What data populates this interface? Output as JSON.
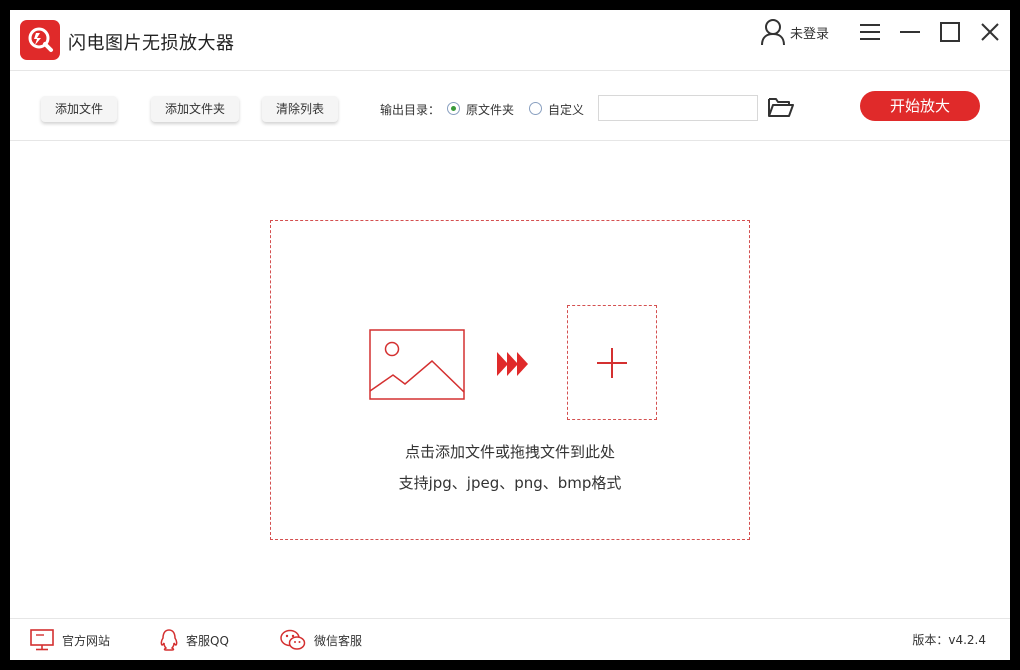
{
  "app": {
    "title": "闪电图片无损放大器"
  },
  "header": {
    "user_label": "未登录"
  },
  "toolbar": {
    "add_file": "添加文件",
    "add_folder": "添加文件夹",
    "clear_list": "清除列表",
    "output_label": "输出目录：",
    "radio_original": "原文件夹",
    "radio_custom": "自定义",
    "selected_output": "原文件夹",
    "path_value": "",
    "start_button": "开始放大"
  },
  "dropzone": {
    "hint_line1": "点击添加文件或拖拽文件到此处",
    "hint_line2": "支持jpg、jpeg、png、bmp格式"
  },
  "footer": {
    "website": "官方网站",
    "qq_service": "客服QQ",
    "wechat_service": "微信客服",
    "version": "版本：v4.2.4"
  },
  "icons": {
    "logo": "app-logo-icon",
    "user": "user-icon",
    "menu": "hamburger-menu-icon",
    "minimize": "minimize-icon",
    "maximize": "maximize-icon",
    "close": "close-icon",
    "folder": "folder-open-icon",
    "image": "image-placeholder-icon",
    "arrows": "triple-arrow-icon",
    "plus": "plus-icon",
    "monitor": "monitor-icon",
    "qq": "qq-icon",
    "wechat": "wechat-icon"
  },
  "colors": {
    "accent": "#e02a2a",
    "dashed_border": "#d45050",
    "radio_check": "#3a9a3a"
  }
}
